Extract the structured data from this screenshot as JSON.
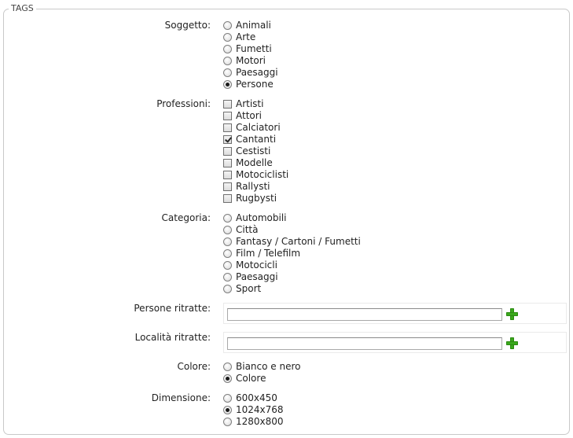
{
  "form": {
    "legend": "TAGS"
  },
  "soggetto": {
    "label": "Soggetto:",
    "options": [
      {
        "label": "Animali",
        "selected": false
      },
      {
        "label": "Arte",
        "selected": false
      },
      {
        "label": "Fumetti",
        "selected": false
      },
      {
        "label": "Motori",
        "selected": false
      },
      {
        "label": "Paesaggi",
        "selected": false
      },
      {
        "label": "Persone",
        "selected": true
      }
    ]
  },
  "professioni": {
    "label": "Professioni:",
    "options": [
      {
        "label": "Artisti",
        "checked": false
      },
      {
        "label": "Attori",
        "checked": false
      },
      {
        "label": "Calciatori",
        "checked": false
      },
      {
        "label": "Cantanti",
        "checked": true
      },
      {
        "label": "Cestisti",
        "checked": false
      },
      {
        "label": "Modelle",
        "checked": false
      },
      {
        "label": "Motociclisti",
        "checked": false
      },
      {
        "label": "Rallysti",
        "checked": false
      },
      {
        "label": "Rugbysti",
        "checked": false
      }
    ]
  },
  "categoria": {
    "label": "Categoria:",
    "options": [
      {
        "label": "Automobili",
        "selected": false
      },
      {
        "label": "Città",
        "selected": false
      },
      {
        "label": "Fantasy / Cartoni / Fumetti",
        "selected": false
      },
      {
        "label": "Film / Telefilm",
        "selected": false
      },
      {
        "label": "Motocicli",
        "selected": false
      },
      {
        "label": "Paesaggi",
        "selected": false
      },
      {
        "label": "Sport",
        "selected": false
      }
    ]
  },
  "persone_ritratte": {
    "label": "Persone ritratte:",
    "value": ""
  },
  "localita_ritratte": {
    "label": "Località ritratte:",
    "value": ""
  },
  "colore": {
    "label": "Colore:",
    "options": [
      {
        "label": "Bianco e nero",
        "selected": false
      },
      {
        "label": "Colore",
        "selected": true
      }
    ]
  },
  "dimensione": {
    "label": "Dimensione:",
    "options": [
      {
        "label": "600x450",
        "selected": false
      },
      {
        "label": "1024x768",
        "selected": true
      },
      {
        "label": "1280x800",
        "selected": false
      }
    ]
  },
  "icons": {
    "add": "plus-icon",
    "add_color": "#3aa81c"
  }
}
